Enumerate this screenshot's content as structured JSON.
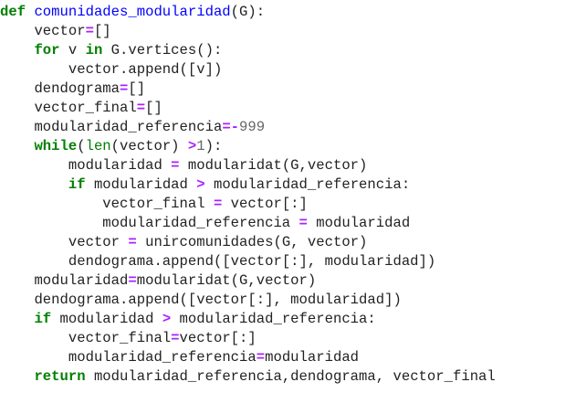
{
  "code": {
    "lines": [
      {
        "indent": "",
        "tokens": [
          {
            "t": "kw",
            "v": "def"
          },
          {
            "t": "p",
            "v": " "
          },
          {
            "t": "nf",
            "v": "comunidades_modularidad"
          },
          {
            "t": "p",
            "v": "(G):"
          }
        ]
      },
      {
        "indent": "    ",
        "tokens": [
          {
            "t": "p",
            "v": "vector"
          },
          {
            "t": "op",
            "v": "="
          },
          {
            "t": "p",
            "v": "[]"
          }
        ]
      },
      {
        "indent": "    ",
        "tokens": [
          {
            "t": "kw",
            "v": "for"
          },
          {
            "t": "p",
            "v": " v "
          },
          {
            "t": "kw",
            "v": "in"
          },
          {
            "t": "p",
            "v": " G.vertices():"
          }
        ]
      },
      {
        "indent": "        ",
        "tokens": [
          {
            "t": "p",
            "v": "vector.append([v])"
          }
        ]
      },
      {
        "indent": "    ",
        "tokens": [
          {
            "t": "p",
            "v": "dendograma"
          },
          {
            "t": "op",
            "v": "="
          },
          {
            "t": "p",
            "v": "[]"
          }
        ]
      },
      {
        "indent": "    ",
        "tokens": [
          {
            "t": "p",
            "v": "vector_final"
          },
          {
            "t": "op",
            "v": "="
          },
          {
            "t": "p",
            "v": "[]"
          }
        ]
      },
      {
        "indent": "    ",
        "tokens": [
          {
            "t": "p",
            "v": "modularidad_referencia"
          },
          {
            "t": "op",
            "v": "=-"
          },
          {
            "t": "mi",
            "v": "999"
          }
        ]
      },
      {
        "indent": "    ",
        "tokens": [
          {
            "t": "kw",
            "v": "while"
          },
          {
            "t": "p",
            "v": "("
          },
          {
            "t": "nb",
            "v": "len"
          },
          {
            "t": "p",
            "v": "(vector) "
          },
          {
            "t": "op",
            "v": ">"
          },
          {
            "t": "mi",
            "v": "1"
          },
          {
            "t": "p",
            "v": "):"
          }
        ]
      },
      {
        "indent": "        ",
        "tokens": [
          {
            "t": "p",
            "v": "modularidad "
          },
          {
            "t": "op",
            "v": "="
          },
          {
            "t": "p",
            "v": " modularidat(G,vector)"
          }
        ]
      },
      {
        "indent": "        ",
        "tokens": [
          {
            "t": "kw",
            "v": "if"
          },
          {
            "t": "p",
            "v": " modularidad "
          },
          {
            "t": "op",
            "v": ">"
          },
          {
            "t": "p",
            "v": " modularidad_referencia:"
          }
        ]
      },
      {
        "indent": "            ",
        "tokens": [
          {
            "t": "p",
            "v": "vector_final "
          },
          {
            "t": "op",
            "v": "="
          },
          {
            "t": "p",
            "v": " vector[:]"
          }
        ]
      },
      {
        "indent": "            ",
        "tokens": [
          {
            "t": "p",
            "v": "modularidad_referencia "
          },
          {
            "t": "op",
            "v": "="
          },
          {
            "t": "p",
            "v": " modularidad"
          }
        ]
      },
      {
        "indent": "        ",
        "tokens": [
          {
            "t": "p",
            "v": "vector "
          },
          {
            "t": "op",
            "v": "="
          },
          {
            "t": "p",
            "v": " unircomunidades(G, vector)"
          }
        ]
      },
      {
        "indent": "        ",
        "tokens": [
          {
            "t": "p",
            "v": "dendograma.append([vector[:], modularidad])"
          }
        ]
      },
      {
        "indent": "    ",
        "tokens": [
          {
            "t": "p",
            "v": "modularidad"
          },
          {
            "t": "op",
            "v": "="
          },
          {
            "t": "p",
            "v": "modularidat(G,vector)"
          }
        ]
      },
      {
        "indent": "    ",
        "tokens": [
          {
            "t": "p",
            "v": "dendograma.append([vector[:], modularidad])"
          }
        ]
      },
      {
        "indent": "    ",
        "tokens": [
          {
            "t": "kw",
            "v": "if"
          },
          {
            "t": "p",
            "v": " modularidad "
          },
          {
            "t": "op",
            "v": ">"
          },
          {
            "t": "p",
            "v": " modularidad_referencia:"
          }
        ]
      },
      {
        "indent": "        ",
        "tokens": [
          {
            "t": "p",
            "v": "vector_final"
          },
          {
            "t": "op",
            "v": "="
          },
          {
            "t": "p",
            "v": "vector[:]"
          }
        ]
      },
      {
        "indent": "        ",
        "tokens": [
          {
            "t": "p",
            "v": "modularidad_referencia"
          },
          {
            "t": "op",
            "v": "="
          },
          {
            "t": "p",
            "v": "modularidad"
          }
        ]
      },
      {
        "indent": "    ",
        "tokens": [
          {
            "t": "kw",
            "v": "return"
          },
          {
            "t": "p",
            "v": " modularidad_referencia,dendograma, vector_final"
          }
        ]
      }
    ]
  },
  "colors": {
    "keyword": "#008000",
    "function_name": "#0000ff",
    "operator": "#aa22ff",
    "number": "#666666",
    "builtin": "#008000",
    "text": "#222222",
    "background": "#ffffff"
  }
}
